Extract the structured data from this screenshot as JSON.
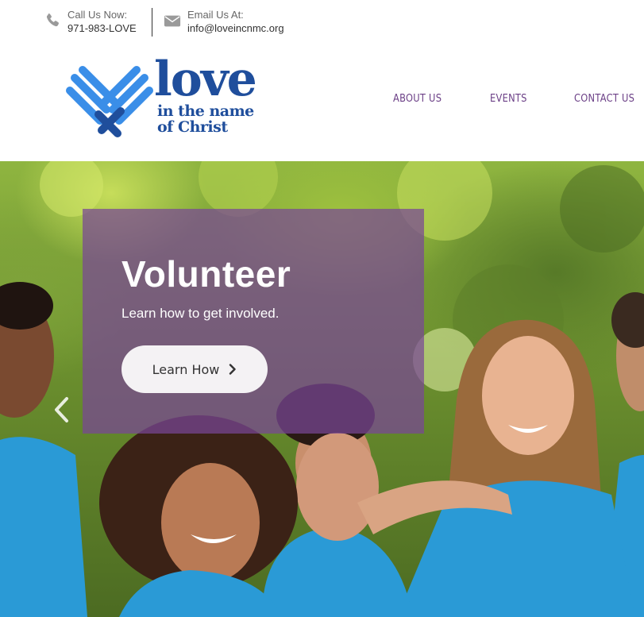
{
  "contact": {
    "phone_label": "Call Us Now:",
    "phone_value": "971-983-LOVE",
    "email_label": "Email Us At:",
    "email_value": "info@loveincnmc.org"
  },
  "logo": {
    "word": "love",
    "line2": "in the name",
    "line3": "of Christ"
  },
  "nav": {
    "items": [
      {
        "label": "ABOUT US"
      },
      {
        "label": "EVENTS"
      },
      {
        "label": "CONTACT US"
      }
    ]
  },
  "hero": {
    "title": "Volunteer",
    "subtitle": "Learn how to get involved.",
    "button_label": "Learn How"
  },
  "icons": {
    "phone": "phone-icon",
    "email": "envelope-icon",
    "button": "chevron-right-icon",
    "prev": "chevron-left-icon"
  },
  "colors": {
    "brand_blue": "#1f4e9c",
    "light_blue": "#3a8ee8",
    "nav_purple": "#6b3f86",
    "overlay_purple": "#784696",
    "shirt_blue": "#2a9ad6"
  }
}
